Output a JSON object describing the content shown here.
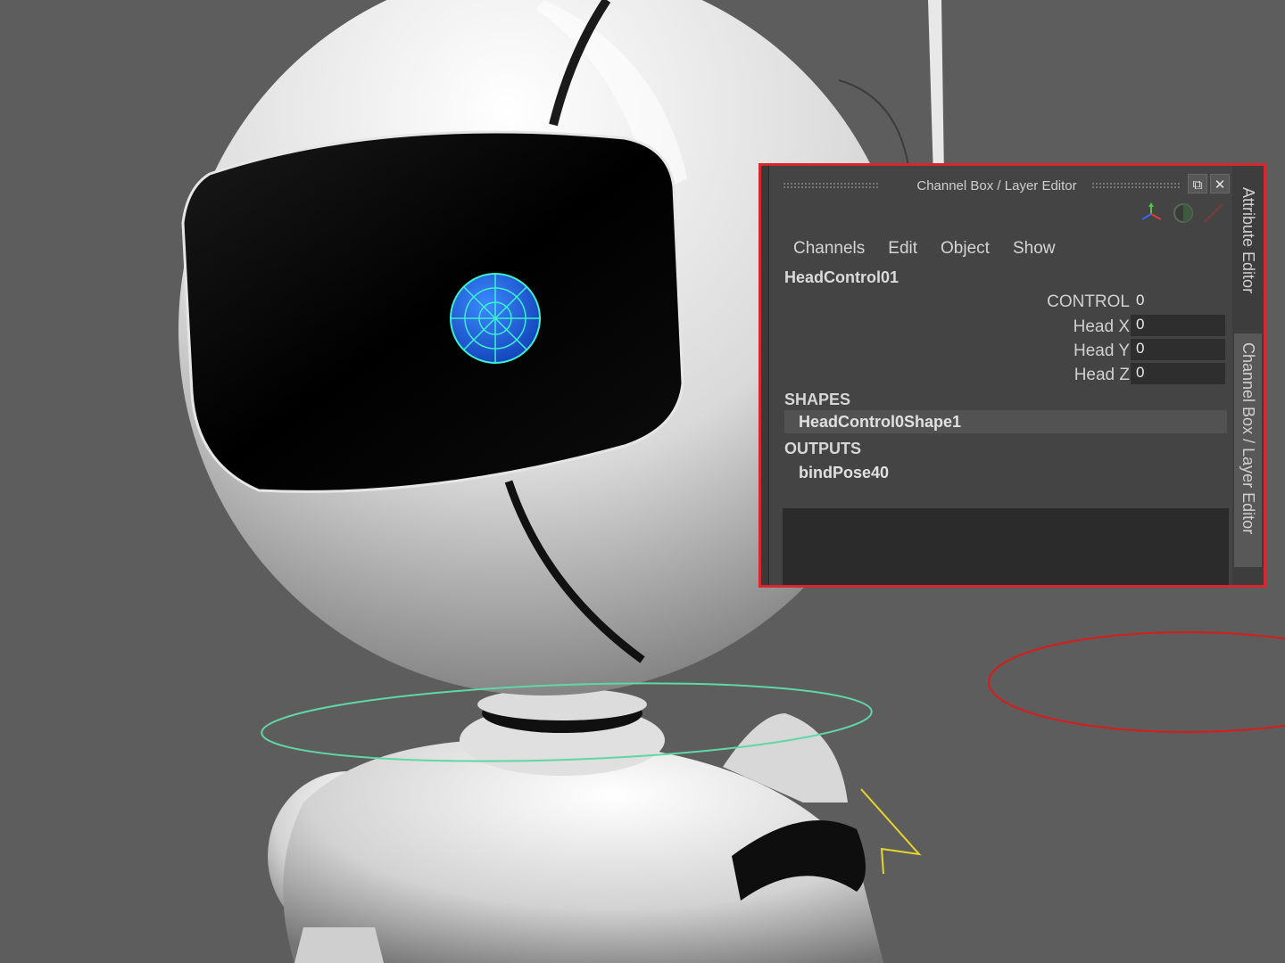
{
  "panel": {
    "title": "Channel Box / Layer Editor",
    "window_buttons": {
      "float": "⧉",
      "close": "✕"
    },
    "menu": [
      "Channels",
      "Edit",
      "Object",
      "Show"
    ],
    "node_name": "HeadControl01",
    "attributes": [
      {
        "label": "CONTROL",
        "value": "0"
      },
      {
        "label": "Head X",
        "value": "0"
      },
      {
        "label": "Head Y",
        "value": "0"
      },
      {
        "label": "Head Z",
        "value": "0"
      }
    ],
    "shapes_header": "SHAPES",
    "shape_item": "HeadControl0Shape1",
    "outputs_header": "OUTPUTS",
    "output_item": "bindPose40",
    "side_tabs": {
      "attribute_editor": "Attribute Editor",
      "channel_box": "Channel Box / Layer Editor"
    },
    "border_color": "#d8262e"
  },
  "viewport": {
    "background": "#5d5d5d",
    "highlight_control_color": "#2a6fe0",
    "neck_ring_color": "#5fd7a8",
    "floor_ring_color": "#d81c1c",
    "locator_color": "#e6d62a"
  }
}
